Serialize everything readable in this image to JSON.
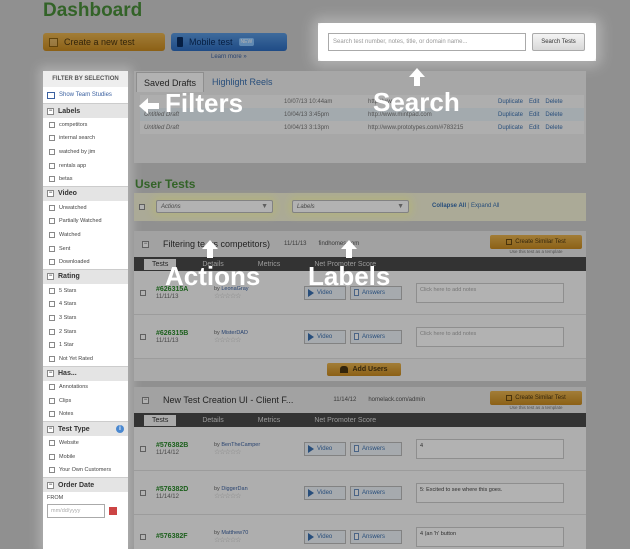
{
  "page_title": "Dashboard",
  "create_button": "Create a new test",
  "mobile_button": "Mobile test",
  "mobile_badge": "NEW",
  "learn_more": "Learn more »",
  "search": {
    "placeholder": "Search test number, notes, title, or domain name...",
    "button": "Search Tests"
  },
  "sidebar": {
    "header": "FILTER BY SELECTION",
    "team_studies": "Show Team Studies",
    "sections": [
      {
        "title": "Labels",
        "items": [
          "competitors",
          "internal search",
          "watched by jim",
          "rentals app",
          "betas"
        ]
      },
      {
        "title": "Video",
        "items": [
          "Unwatched",
          "Partially Watched",
          "Watched",
          "Sent",
          "Downloaded"
        ]
      },
      {
        "title": "Rating",
        "items": [
          "5 Stars",
          "4 Stars",
          "3 Stars",
          "2 Stars",
          "1 Star",
          "Not Yet Rated"
        ]
      },
      {
        "title": "Has...",
        "items": [
          "Annotations",
          "Clips",
          "Notes"
        ]
      },
      {
        "title": "Test Type",
        "items": [
          "Website",
          "Mobile",
          "Your Own Customers"
        ]
      },
      {
        "title": "Order Date",
        "items": []
      }
    ],
    "from_label": "FROM",
    "date_placeholder": "mm/dd/yyyy"
  },
  "drafts": {
    "tab_saved": "Saved Drafts",
    "tab_reels": "Highlight Reels",
    "rows": [
      {
        "name": "",
        "date": "10/07/13 10:44am",
        "url": "http://www.",
        "actions": [
          "Duplicate",
          "Edit",
          "Delete"
        ]
      },
      {
        "name": "Untitled Draft",
        "date": "10/04/13 3:45pm",
        "url": "http://www.mintpad.com",
        "actions": [
          "Duplicate",
          "Edit",
          "Delete"
        ]
      },
      {
        "name": "Untitled Draft",
        "date": "10/04/13 3:13pm",
        "url": "http://www.prototypes.com/#783215",
        "actions": [
          "Duplicate",
          "Edit",
          "Delete"
        ]
      }
    ]
  },
  "user_tests": {
    "title": "User Tests",
    "actions_select": "Actions",
    "labels_select": "Labels",
    "collapse_all": "Collapse All",
    "expand_all": "Expand All",
    "groups": [
      {
        "title": "Filtering te",
        "title_tail": "vs competitors)",
        "date": "11/11/13",
        "url": "findhomes.com",
        "similar_button": "Create Similar Test",
        "similar_note": "Use this test as a template",
        "tabs": [
          "Tests",
          "Details",
          "Metrics",
          "Net Promoter Score"
        ],
        "rows": [
          {
            "id": "#626315A",
            "date": "11/11/13",
            "by": "by",
            "user": "LeonaGray",
            "video": "Video",
            "answers": "Answers",
            "notes": "Click here to add notes"
          },
          {
            "id": "#626315B",
            "date": "11/11/13",
            "by": "by",
            "user": "MisterDAD",
            "video": "Video",
            "answers": "Answers",
            "notes": "Click here to add notes"
          }
        ],
        "add_users": "Add Users"
      },
      {
        "title": "New Test Creation UI - Client F...",
        "date": "11/14/12",
        "url": "homelack.com/admin",
        "similar_button": "Create Similar Test",
        "similar_note": "Use this test as a template",
        "tabs": [
          "Tests",
          "Details",
          "Metrics",
          "Net Promoter Score"
        ],
        "rows": [
          {
            "id": "#576382B",
            "date": "11/14/12",
            "by": "by",
            "user": "BenTheCamper",
            "video": "Video",
            "answers": "Answers",
            "notes": "4"
          },
          {
            "id": "#576382D",
            "date": "11/14/12",
            "by": "by",
            "user": "DiggerDan",
            "video": "Video",
            "answers": "Answers",
            "notes": "5: Excited to see where this goes."
          },
          {
            "id": "#576382F",
            "date": "",
            "by": "by",
            "user": "Matthew70",
            "video": "Video",
            "answers": "Answers",
            "notes": "4 (an 'h' button"
          }
        ]
      }
    ]
  },
  "callouts": {
    "filters": "Filters",
    "search": "Search",
    "actions": "Actions",
    "labels": "Labels"
  }
}
